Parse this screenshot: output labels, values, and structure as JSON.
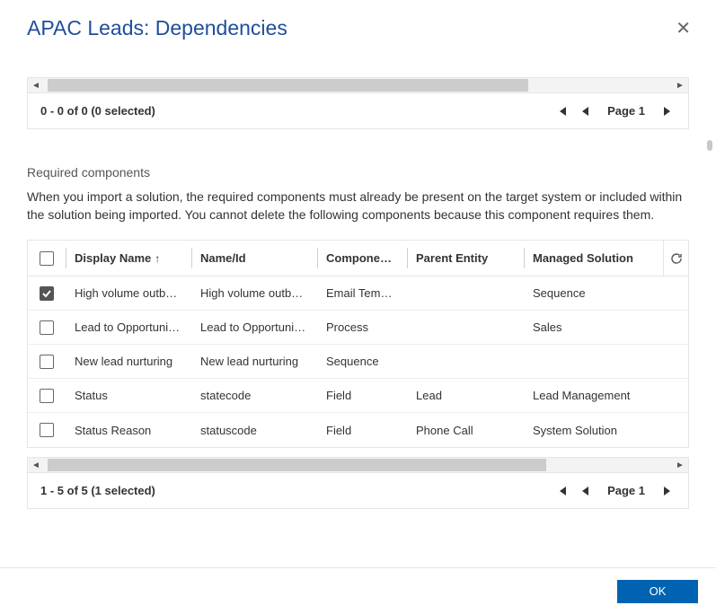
{
  "header": {
    "title": "APAC Leads: Dependencies"
  },
  "top_pager": {
    "status": "0 - 0 of 0 (0 selected)",
    "page_label": "Page 1"
  },
  "required_section": {
    "heading": "Required components",
    "description": "When you import a solution, the required components must already be present on the target system or included within the solution being imported. You cannot delete the following components because this component requires them."
  },
  "grid": {
    "columns": {
      "display_name": "Display Name",
      "name_id": "Name/Id",
      "component_type": "Component T...",
      "parent_entity": "Parent Entity",
      "managed_solution": "Managed Solution"
    },
    "rows": [
      {
        "checked": true,
        "display": "High volume outbou...",
        "name": "High volume outbou...",
        "type": "Email Template",
        "parent": "",
        "solution": "Sequence"
      },
      {
        "checked": false,
        "display": "Lead to Opportunity...",
        "name": "Lead to Opportunity...",
        "type": "Process",
        "parent": "",
        "solution": "Sales"
      },
      {
        "checked": false,
        "display": "New lead nurturing",
        "name": "New lead nurturing",
        "type": "Sequence",
        "parent": "",
        "solution": ""
      },
      {
        "checked": false,
        "display": "Status",
        "name": "statecode",
        "type": "Field",
        "parent": "Lead",
        "solution": "Lead Management"
      },
      {
        "checked": false,
        "display": "Status Reason",
        "name": "statuscode",
        "type": "Field",
        "parent": "Phone Call",
        "solution": "System Solution"
      }
    ]
  },
  "bottom_pager": {
    "status": "1 - 5 of 5 (1 selected)",
    "page_label": "Page 1"
  },
  "footer": {
    "ok": "OK"
  }
}
